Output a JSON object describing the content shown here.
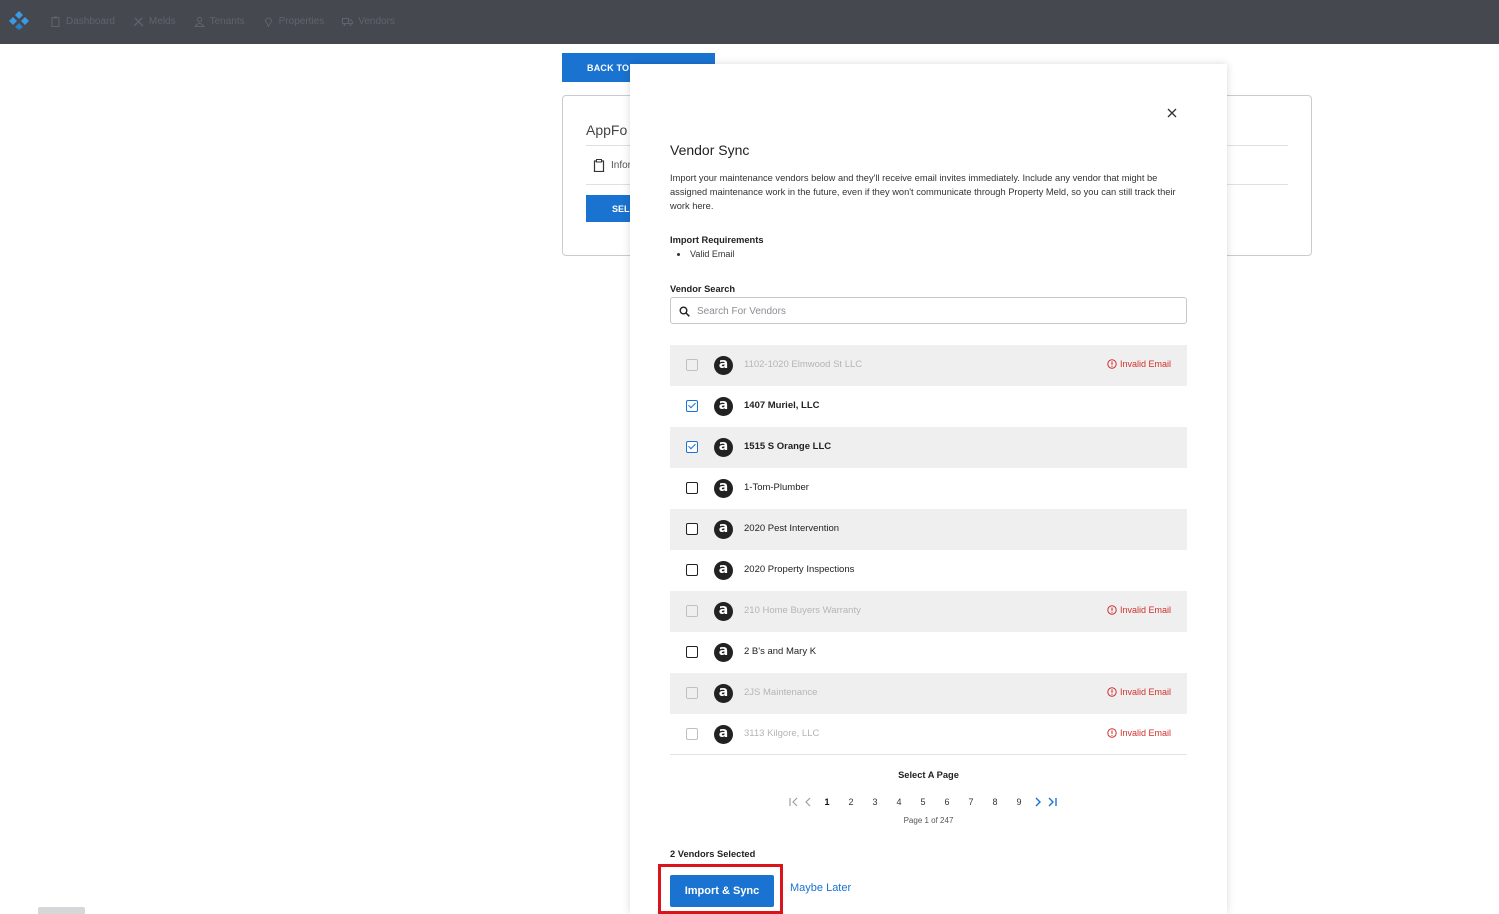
{
  "topnav": {
    "items": [
      {
        "label": "Dashboard",
        "icon": "clipboard-icon"
      },
      {
        "label": "Melds",
        "icon": "tools-icon"
      },
      {
        "label": "Tenants",
        "icon": "person-icon"
      },
      {
        "label": "Properties",
        "icon": "map-pin-icon"
      },
      {
        "label": "Vendors",
        "icon": "truck-icon"
      }
    ]
  },
  "background": {
    "back_button": "BACK TO I",
    "card_title": "AppFo",
    "info_text": "Infor",
    "select_button": "SELE"
  },
  "modal": {
    "title": "Vendor Sync",
    "description": "Import your maintenance vendors below and they'll receive email invites immediately. Include any vendor that might be assigned maintenance work in the future, even if they won't communicate through Property Meld, so you can still track their work here.",
    "requirements_title": "Import Requirements",
    "requirements": [
      "Valid Email"
    ],
    "search_label": "Vendor Search",
    "search_placeholder": "Search For Vendors",
    "vendors": [
      {
        "name": "1102-1020 Elmwood St LLC",
        "checked": false,
        "disabled": true,
        "invalid": "Invalid Email"
      },
      {
        "name": "1407 Muriel, LLC",
        "checked": true,
        "disabled": false,
        "invalid": ""
      },
      {
        "name": "1515 S Orange LLC",
        "checked": true,
        "disabled": false,
        "invalid": ""
      },
      {
        "name": "1-Tom-Plumber",
        "checked": false,
        "disabled": false,
        "invalid": ""
      },
      {
        "name": "2020 Pest Intervention",
        "checked": false,
        "disabled": false,
        "invalid": ""
      },
      {
        "name": "2020 Property Inspections",
        "checked": false,
        "disabled": false,
        "invalid": ""
      },
      {
        "name": "210 Home Buyers Warranty",
        "checked": false,
        "disabled": true,
        "invalid": "Invalid Email"
      },
      {
        "name": "2 B's and Mary K",
        "checked": false,
        "disabled": false,
        "invalid": ""
      },
      {
        "name": "2JS Maintenance",
        "checked": false,
        "disabled": true,
        "invalid": "Invalid Email"
      },
      {
        "name": "3113 Kilgore, LLC",
        "checked": false,
        "disabled": true,
        "invalid": "Invalid Email"
      }
    ],
    "pagination": {
      "label": "Select A Page",
      "pages": [
        "1",
        "2",
        "3",
        "4",
        "5",
        "6",
        "7",
        "8",
        "9"
      ],
      "current": "1",
      "page_of": "Page 1 of 247"
    },
    "selected_count": "2 Vendors Selected",
    "import_button": "Import & Sync",
    "maybe_later": "Maybe Later",
    "colors": {
      "accent": "#1a73d0",
      "error": "#d0312d",
      "highlight_box": "#d9141b"
    }
  }
}
